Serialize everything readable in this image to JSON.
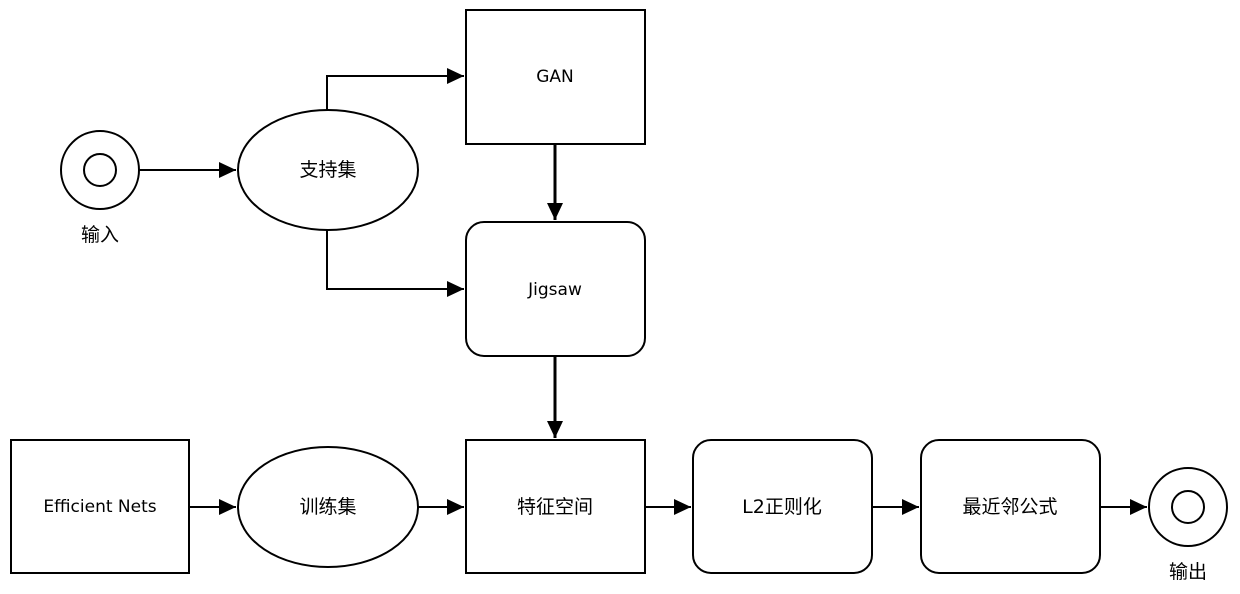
{
  "diagram": {
    "nodes": {
      "input": {
        "label": "输入",
        "shape": "terminal-circle"
      },
      "support_set": {
        "label": "支持集",
        "shape": "ellipse"
      },
      "gan": {
        "label": "GAN",
        "shape": "rectangle"
      },
      "jigsaw": {
        "label": "Jigsaw",
        "shape": "rounded-rectangle"
      },
      "efficient_nets": {
        "label": "Efficient Nets",
        "shape": "rectangle"
      },
      "training_set": {
        "label": "训练集",
        "shape": "ellipse"
      },
      "feature_space": {
        "label": "特征空间",
        "shape": "rectangle"
      },
      "l2_norm": {
        "label": "L2正则化",
        "shape": "rounded-rectangle"
      },
      "nearest_neighbor": {
        "label": "最近邻公式",
        "shape": "rounded-rectangle"
      },
      "output": {
        "label": "输出",
        "shape": "terminal-circle"
      }
    },
    "edges": [
      {
        "from": "input",
        "to": "support_set"
      },
      {
        "from": "support_set",
        "to": "gan"
      },
      {
        "from": "support_set",
        "to": "jigsaw"
      },
      {
        "from": "gan",
        "to": "jigsaw"
      },
      {
        "from": "jigsaw",
        "to": "feature_space"
      },
      {
        "from": "efficient_nets",
        "to": "training_set"
      },
      {
        "from": "training_set",
        "to": "feature_space"
      },
      {
        "from": "feature_space",
        "to": "l2_norm"
      },
      {
        "from": "l2_norm",
        "to": "nearest_neighbor"
      },
      {
        "from": "nearest_neighbor",
        "to": "output"
      }
    ]
  }
}
